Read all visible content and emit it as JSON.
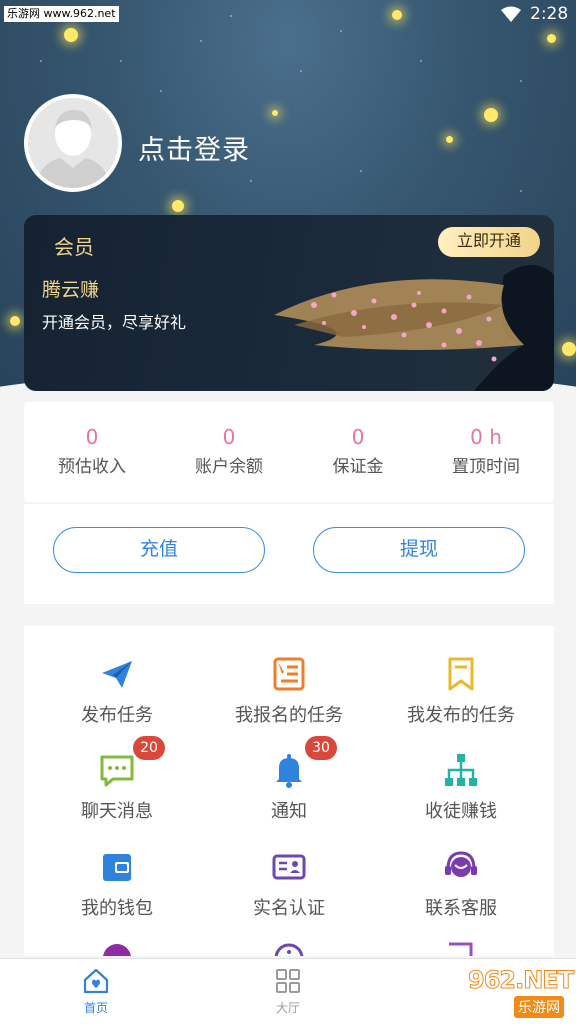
{
  "status_bar": {
    "watermark": "乐游网 www.962.net",
    "time": "2:28",
    "wifi_icon": "wifi-icon"
  },
  "profile": {
    "login_text": "点击登录",
    "avatar_icon": "default-avatar-icon"
  },
  "vip_card": {
    "title": "会员",
    "button": "立即开通",
    "name": "腾云赚",
    "desc": "开通会员，尽享好礼",
    "gold_color": "#f0d48c"
  },
  "stats": [
    {
      "value": "0",
      "label": "预估收入"
    },
    {
      "value": "0",
      "label": "账户余额"
    },
    {
      "value": "0",
      "label": "保证金"
    },
    {
      "value": "0 h",
      "label": "置顶时间"
    }
  ],
  "actions": {
    "recharge": "充值",
    "withdraw": "提现",
    "accent": "#2f83df"
  },
  "grid": [
    {
      "label": "发布任务",
      "icon": "paper-plane-icon",
      "badge": ""
    },
    {
      "label": "我报名的任务",
      "icon": "edit-note-icon",
      "badge": ""
    },
    {
      "label": "我发布的任务",
      "icon": "bookmark-icon",
      "badge": ""
    },
    {
      "label": "聊天消息",
      "icon": "chat-icon",
      "badge": "20"
    },
    {
      "label": "通知",
      "icon": "bell-icon",
      "badge": "30"
    },
    {
      "label": "收徒赚钱",
      "icon": "org-chart-icon",
      "badge": ""
    },
    {
      "label": "我的钱包",
      "icon": "wallet-icon",
      "badge": ""
    },
    {
      "label": "实名认证",
      "icon": "id-card-icon",
      "badge": ""
    },
    {
      "label": "联系客服",
      "icon": "headset-icon",
      "badge": ""
    }
  ],
  "tabbar": [
    {
      "label": "首页",
      "icon": "home-icon",
      "active": true
    },
    {
      "label": "大厅",
      "icon": "grid-icon",
      "active": false
    }
  ],
  "bottom_watermark": {
    "big": "962.NET",
    "small": "乐游网"
  }
}
